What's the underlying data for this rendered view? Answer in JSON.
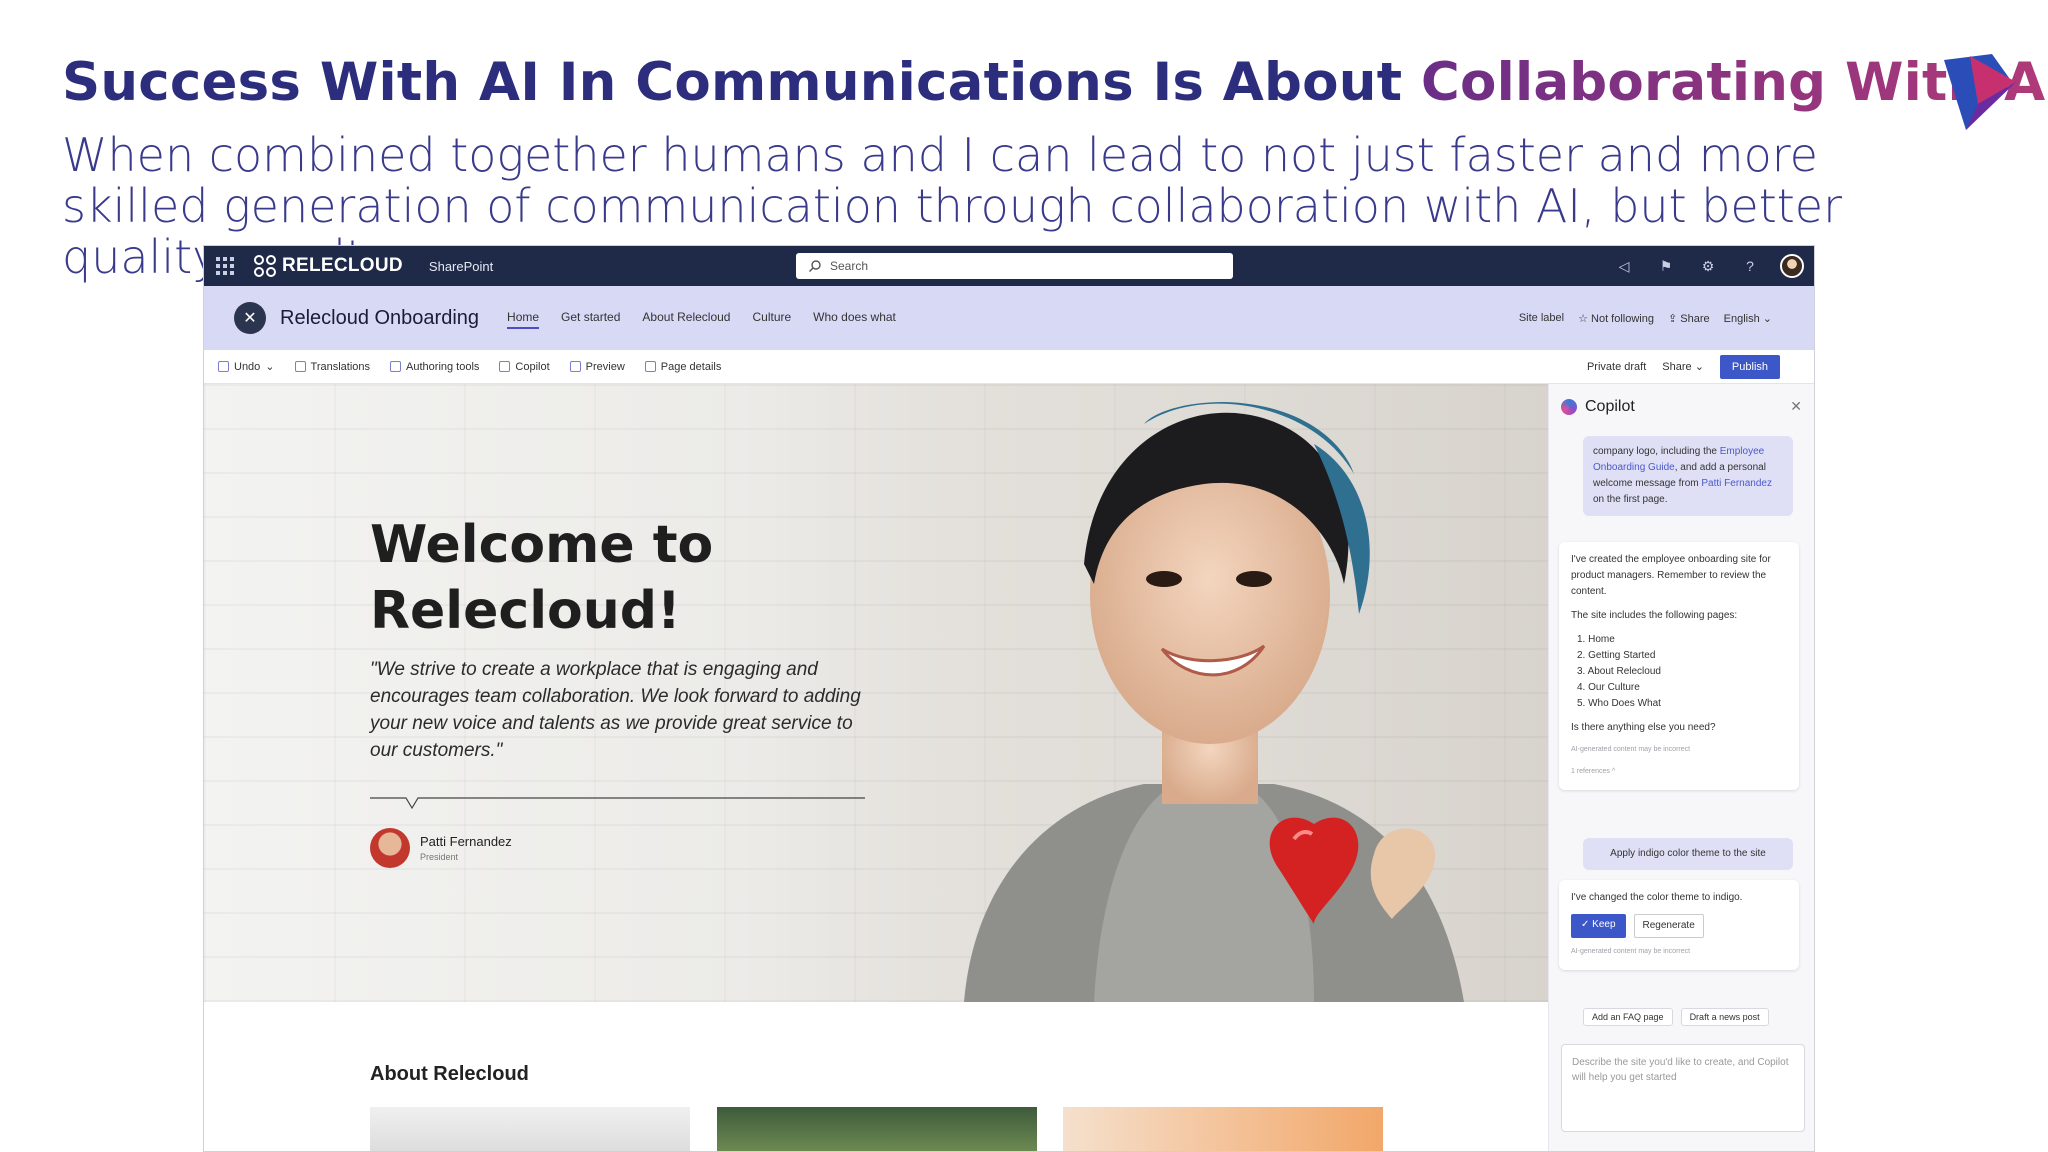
{
  "slide": {
    "title_main": "Success With AI In Communications Is About ",
    "title_accent": "Collaborating With AI",
    "subtitle": "When combined together humans and I can lead to not just faster and more skilled generation of communication through collaboration with AI, but better quality results."
  },
  "suitebar": {
    "brand": "RELECLOUD",
    "app": "SharePoint",
    "search_placeholder": "Search"
  },
  "site": {
    "title": "Relecloud Onboarding",
    "nav": [
      "Home",
      "Get started",
      "About Relecloud",
      "Culture",
      "Who does what"
    ],
    "right": [
      "Site label",
      "☆ Not following",
      "⇪ Share",
      "English ⌄"
    ]
  },
  "commandbar": {
    "left": [
      "Undo",
      "Translations",
      "Authoring tools",
      "Copilot",
      "Preview",
      "Page details"
    ],
    "private_draft": "Private draft",
    "share": "Share",
    "publish": "Publish"
  },
  "hero": {
    "heading": "Welcome to Relecloud!",
    "quote": "\"We strive to create a workplace that is engaging and encourages team collaboration. We look forward to adding your new voice and talents as we provide great service to our customers.\"",
    "author_name": "Patti Fernandez",
    "author_role": "President"
  },
  "about": {
    "heading": "About Relecloud"
  },
  "copilot": {
    "title": "Copilot",
    "user1_a": "company logo, including the ",
    "user1_link1": "Employee Onboarding Guide",
    "user1_b": ", and add a personal welcome message from ",
    "user1_link2": "Patti Fernandez",
    "user1_c": " on the first page.",
    "bot1_intro": "I've created the employee onboarding site for product managers. Remember to review the content.",
    "bot1_list_intro": "The site includes the following pages:",
    "bot1_pages": [
      "1. Home",
      "2. Getting Started",
      "3. About Relecloud",
      "4. Our Culture",
      "5. Who Does What"
    ],
    "bot1_question": "Is there anything else you need?",
    "disclaimer": "AI-generated content may be incorrect",
    "references": "1 references ^",
    "user2": "Apply indigo color theme to the site",
    "bot2": "I've changed the color theme to indigo.",
    "keep": "✓ Keep",
    "regenerate": "Regenerate",
    "chips": [
      "Add an FAQ page",
      "Draft a news post"
    ],
    "input_placeholder": "Describe the site you'd like to create, and Copilot will help you get started"
  }
}
